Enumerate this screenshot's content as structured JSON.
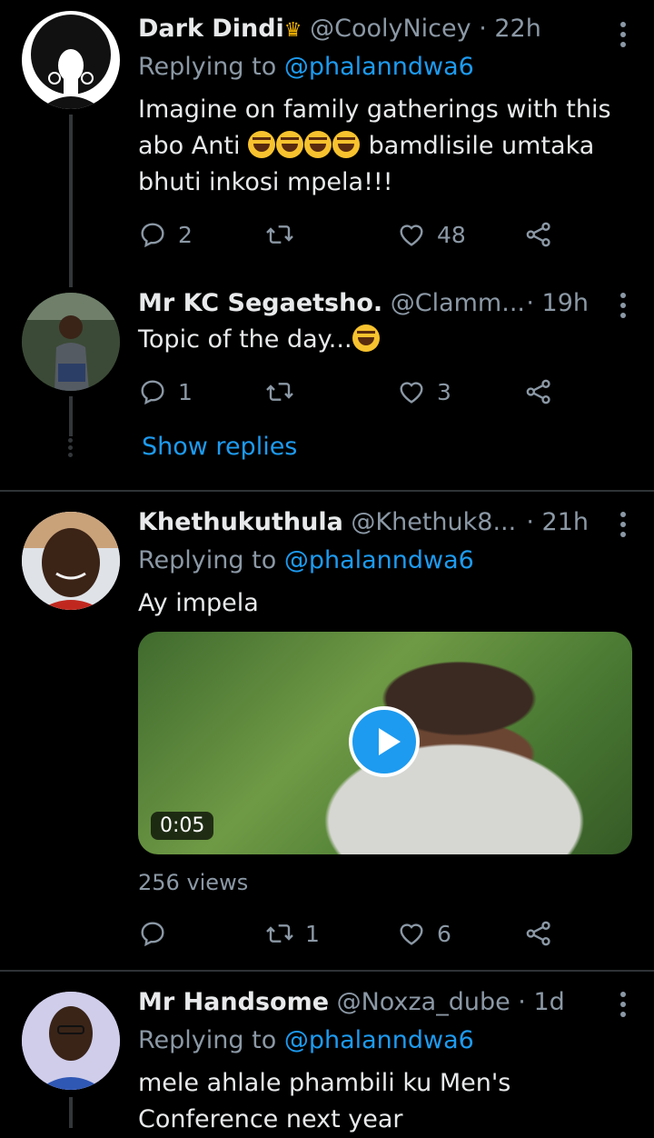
{
  "tweets": [
    {
      "name": "Dark Dindi",
      "name_badge": "crown-emoji",
      "handle": "@CoolyNicey",
      "time": "· 22h",
      "replying_prefix": "Replying to ",
      "replying_to": "@phalanndwa6",
      "text_line1": "Imagine on family gatherings with this",
      "text_line2a": "abo Anti",
      "text_line2b": "bamdlisile umtaka",
      "text_line3": "bhuti inkosi mpela!!!",
      "replies": "2",
      "retweets": "",
      "likes": "48"
    },
    {
      "name": "Mr KC Segaetsho.",
      "handle": "@Clamm...",
      "time": "· 19h",
      "text": "Topic of the day...",
      "replies": "1",
      "retweets": "",
      "likes": "3",
      "show_replies": "Show replies"
    },
    {
      "name": "Khethukuthula",
      "handle": "@Khethuk8...",
      "time": "· 21h",
      "replying_prefix": "Replying to ",
      "replying_to": "@phalanndwa6",
      "text": "Ay impela",
      "video_duration": "0:05",
      "views": "256 views",
      "replies": "",
      "retweets": "1",
      "likes": "6"
    },
    {
      "name": "Mr Handsome",
      "handle": "@Noxza_dube",
      "time": "· 1d",
      "replying_prefix": "Replying to ",
      "replying_to": "@phalanndwa6",
      "text_line1": "mele ahlale phambili ku Men's",
      "text_line2": "Conference next year"
    }
  ],
  "colors": {
    "accent": "#1d9bf0",
    "muted": "#8b98a5",
    "text": "#e7e9ea",
    "background": "#000000"
  }
}
